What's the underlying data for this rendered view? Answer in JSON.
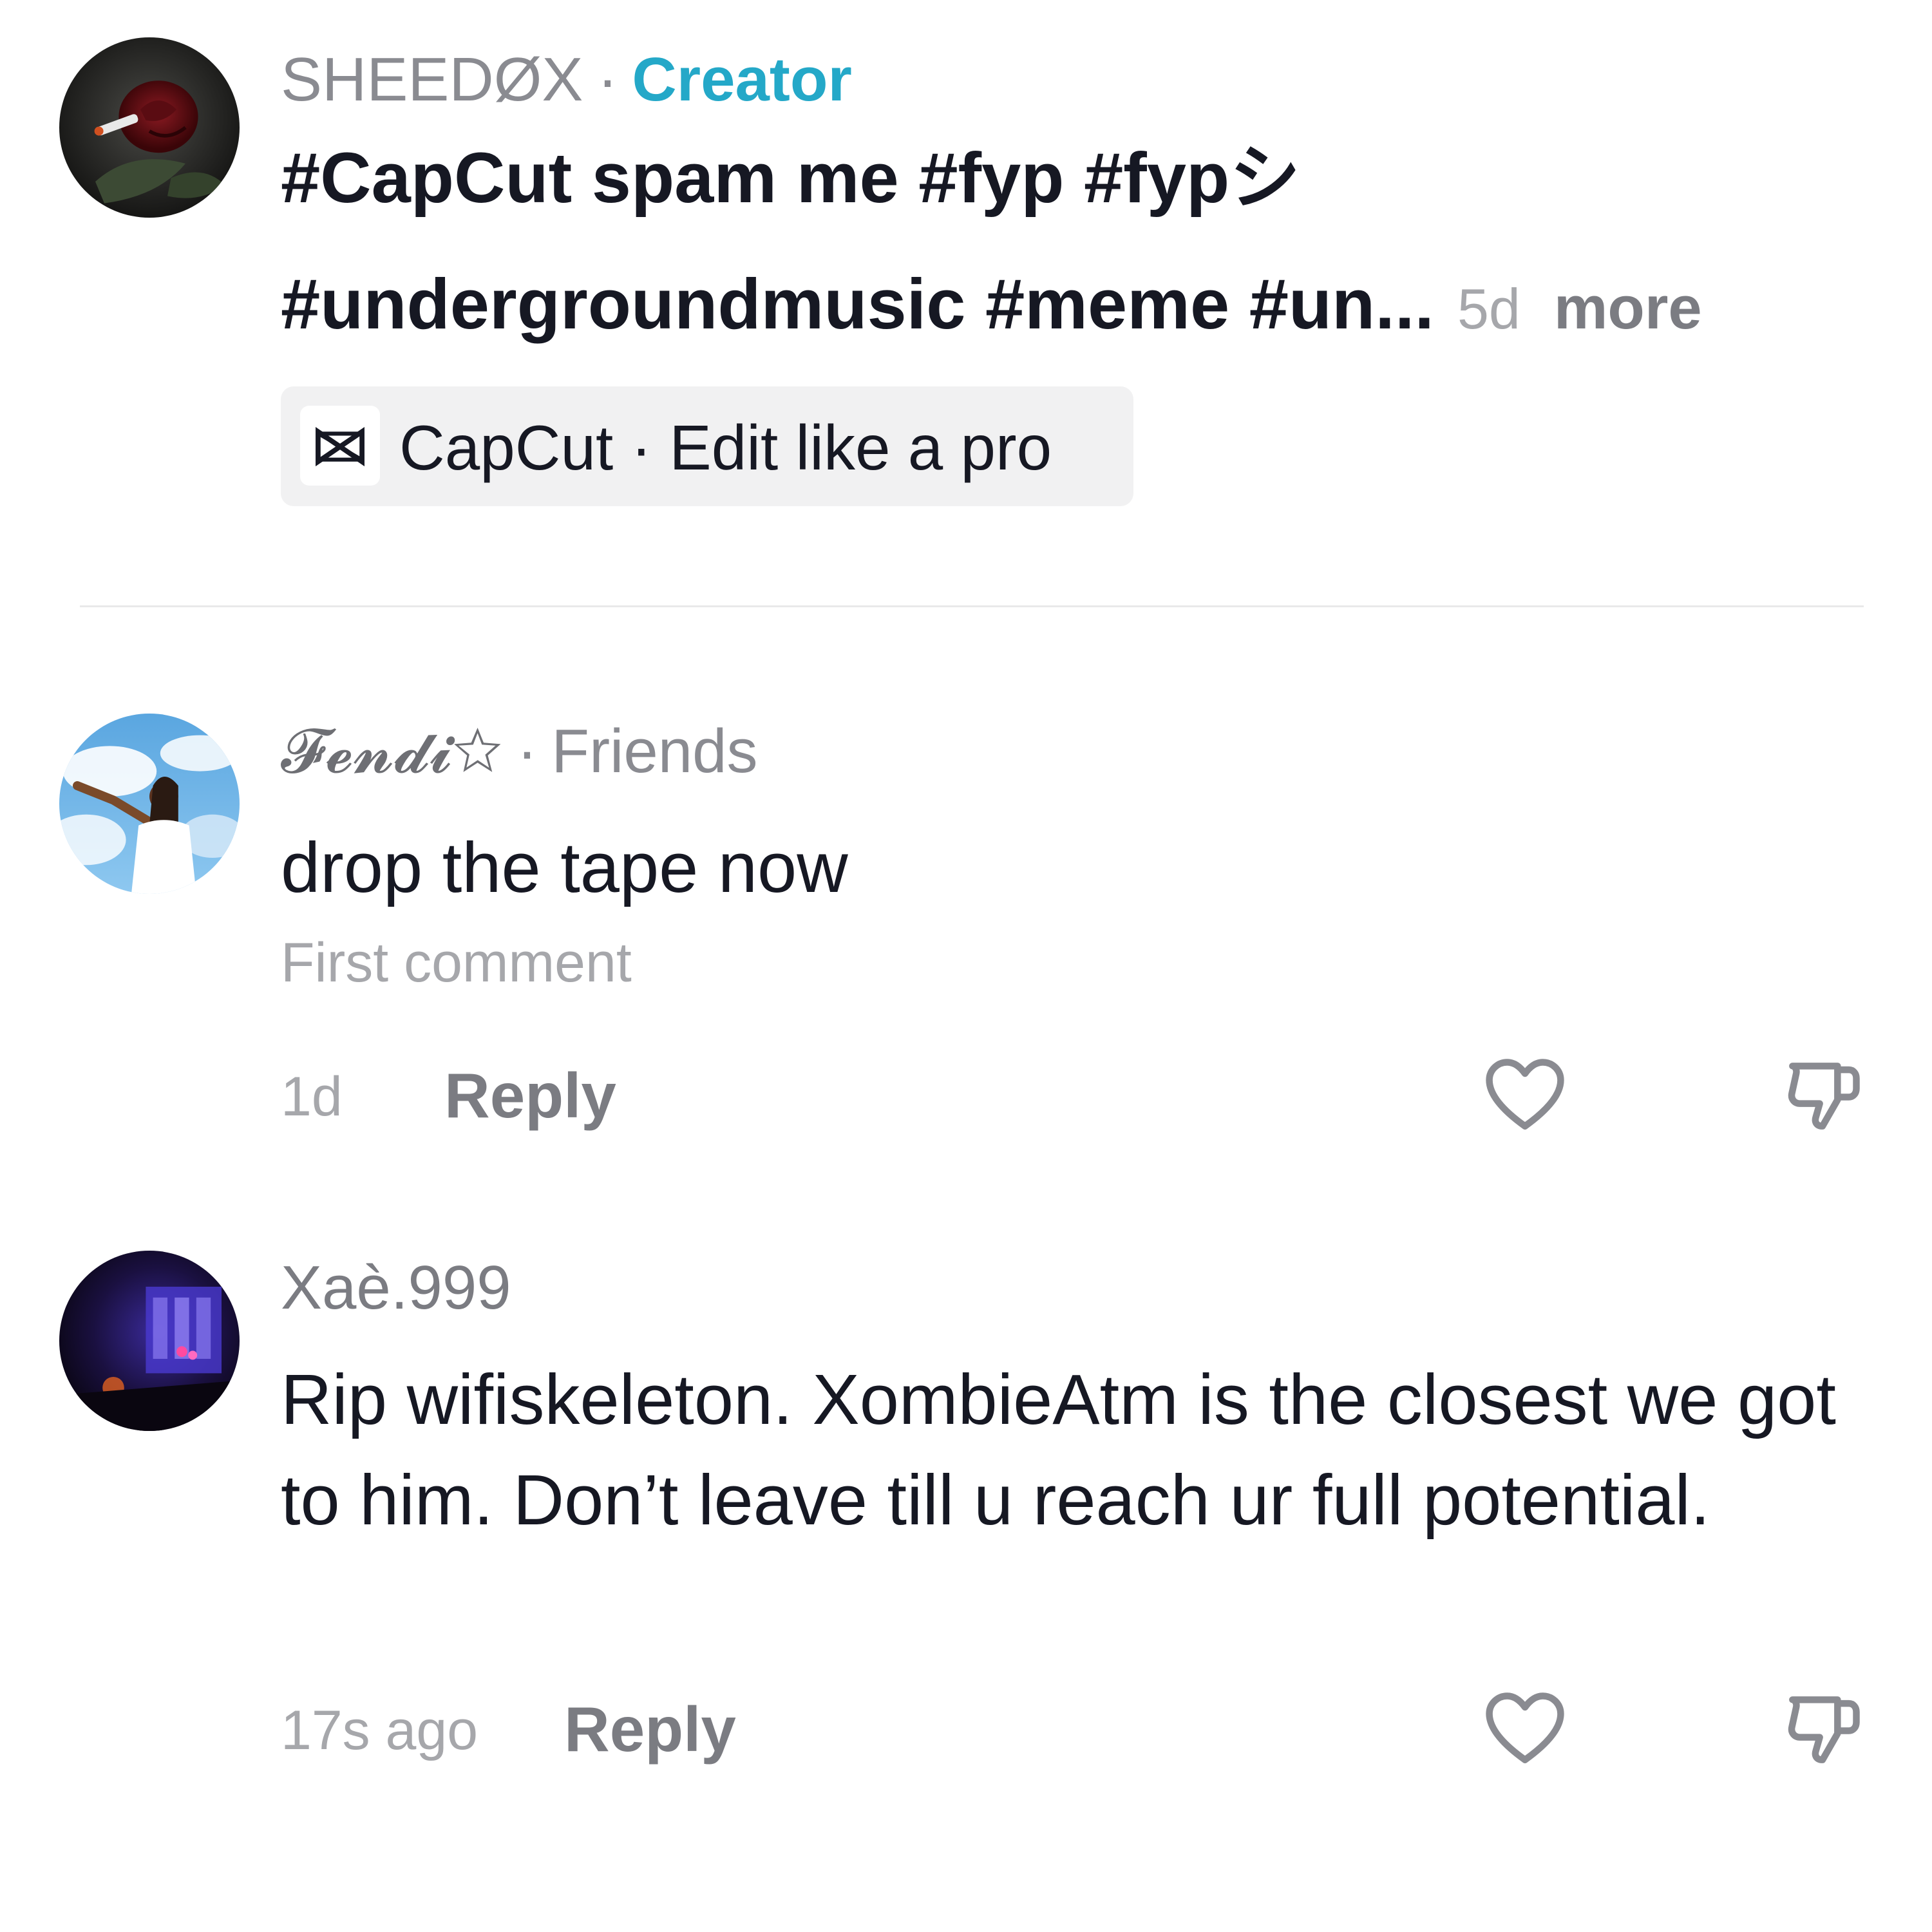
{
  "caption": {
    "username": "SHEEDØX",
    "separator": "·",
    "role": "Creator",
    "line1": "#CapCut spam me #fyp #fypシ",
    "line2": "#undergroundmusic #meme #un...",
    "age": "5d",
    "more_label": "more",
    "anchor": {
      "icon": "capcut-icon",
      "label": "CapCut · Edit like a pro"
    }
  },
  "comments": [
    {
      "username": "𝓕𝓮𝓷𝓭𝓲☆",
      "separator": "·",
      "relation": "Friends",
      "text": "drop the tape now",
      "tag": "First comment",
      "time": "1d",
      "reply_label": "Reply"
    },
    {
      "username": "Xaè.999",
      "text": "Rip wifiskeleton. XombieAtm is the closest we got to him. Don’t leave till u reach ur full potential.",
      "time": "17s ago",
      "reply_label": "Reply"
    }
  ],
  "icons": {
    "like": "heart-outline-icon",
    "dislike": "thumbs-down-icon"
  },
  "colors": {
    "creator_accent": "#24a8c8",
    "text_primary": "#161823",
    "text_secondary": "#8a8b91",
    "anchor_bg": "#f1f1f2"
  }
}
